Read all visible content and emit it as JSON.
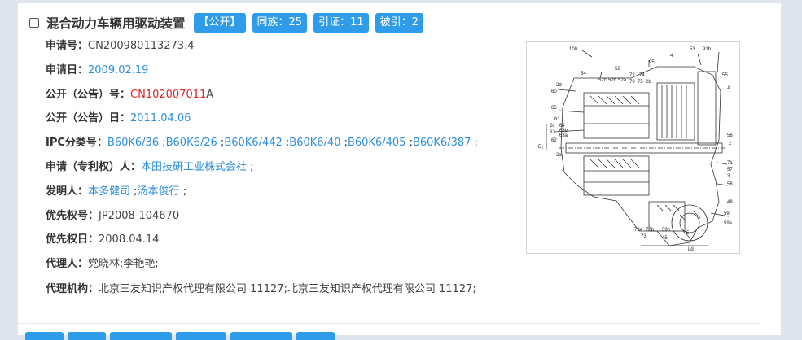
{
  "record": {
    "title": "混合动力车辆用驱动装置",
    "tags": {
      "status": "【公开】",
      "family": "同族：25",
      "cites": "引证：11",
      "cited_by": "被引：2"
    },
    "fields": {
      "app_no_label": "申请号：",
      "app_no": "CN200980113273.4",
      "app_date_label": "申请日：",
      "app_date": "2009.02.19",
      "pub_no_label": "公开（公告）号：",
      "pub_no_link": "CN102007011",
      "pub_no_suffix": "A",
      "pub_date_label": "公开（公告）日：",
      "pub_date": "2011.04.06",
      "ipc_label": "IPC分类号：",
      "ipc": [
        "B60K6/36",
        "B60K6/26",
        "B60K6/442",
        "B60K6/40",
        "B60K6/405",
        "B60K6/387"
      ],
      "applicant_label": "申请（专利权）人：",
      "applicant": "本田技研工业株式会社",
      "inventor_label": "发明人：",
      "inventors": [
        "本多健司",
        "汤本俊行"
      ],
      "priority_no_label": "优先权号：",
      "priority_no": "JP2008-104670",
      "priority_date_label": "优先权日：",
      "priority_date": "2008.04.14",
      "agent_label": "代理人：",
      "agent": "党晓林;李艳艳;",
      "agency_label": "代理机构：",
      "agency": "北京三友知识产权代理有限公司 11127;北京三友知识产权代理有限公司 11127;"
    },
    "drawing_labels": {
      "ref_100": "100",
      "n53": "53",
      "n91b": "91b",
      "n95": "95",
      "n4": "4",
      "n55": "55",
      "n54": "54",
      "n52": "52",
      "n72": "72",
      "n74": "74",
      "nA": "A",
      "n52c": "52c",
      "n52b": "52b",
      "n52a": "52a",
      "n70": "70",
      "n75": "75",
      "n2b": "2b",
      "n60": "60",
      "n65": "65",
      "n2d": "2d",
      "n61": "61",
      "n2c": "2c",
      "n64": "64",
      "n63b": "63b",
      "n63": "63",
      "n63a": "63a",
      "n62": "62",
      "nDb": "D₁",
      "n56": "56",
      "n2": "2",
      "n71": "71",
      "n57": "57",
      "n3": "3",
      "n58": "58",
      "n2a": "2a",
      "n1": "1",
      "n48": "48",
      "n59": "59",
      "n59a": "59a",
      "n73a": "73a",
      "n73b": "73b",
      "n73": "73",
      "n59b": "59b",
      "n45": "45",
      "n5": "5",
      "nLd": "Ld"
    }
  }
}
